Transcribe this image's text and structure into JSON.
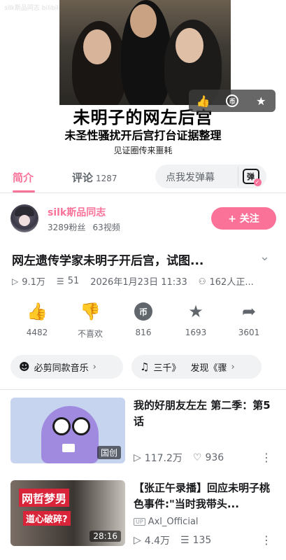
{
  "video": {
    "watermark": "silk斯品同志 bilibili",
    "title_main": "未明子的网左后宫",
    "title_sub": "未圣性骚扰开后宫打台证据整理",
    "caption": "见证圈传来噩耗"
  },
  "tabs": {
    "intro": "简介",
    "comments": "评论",
    "comments_count": "1287",
    "danmaku_placeholder": "点我发弹幕",
    "danmaku_icon_text": "弹"
  },
  "uploader": {
    "name": "silk斯品同志",
    "fans": "3289粉丝",
    "videos": "63视频",
    "follow_label": "+ 关注"
  },
  "video_info": {
    "title": "网左遗传学家未明子开后宫，试图...",
    "views": "9.1万",
    "danmaku_count": "51",
    "date": "2026年1月23日 11:33",
    "watching": "162人正..."
  },
  "actions": {
    "like": "4482",
    "dislike": "不喜欢",
    "coin": "816",
    "favorite": "1693",
    "share": "3601"
  },
  "tags": {
    "tag1": "必剪同款音乐",
    "tag2_song": "三千》",
    "tag2_discover": "发现《骤"
  },
  "recommendations": [
    {
      "title": "我的好朋友左左 第二季：第5话",
      "badge": "国创",
      "views": "117.2万",
      "likes": "936"
    },
    {
      "title": "【张正午录播】回应未明子桃色事件:\"当时我带头...",
      "thumb_text1": "网哲梦男",
      "thumb_text2": "道心破碎?",
      "duration": "28:16",
      "up_tag": "UP",
      "uploader": "Axl_Official",
      "views": "4.4万",
      "danmaku": "135"
    }
  ],
  "colors": {
    "accent": "#fb7299",
    "text_primary": "#18191c",
    "text_secondary": "#61666d"
  }
}
